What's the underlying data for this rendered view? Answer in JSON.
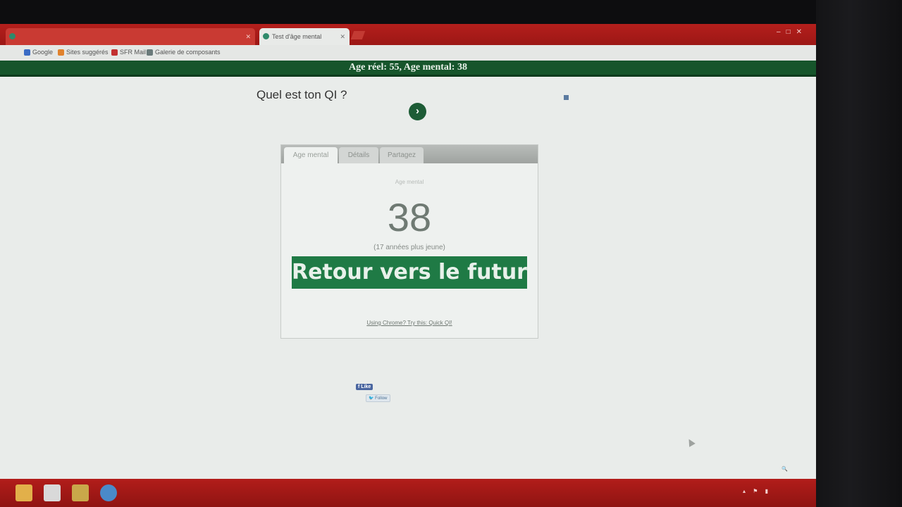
{
  "browser": {
    "tabs": [
      {
        "title": "",
        "active": false
      },
      {
        "title": "Test d'âge mental",
        "active": true
      }
    ],
    "bookmarks": [
      {
        "label": "Google",
        "color": "#3b6cc5"
      },
      {
        "label": "Sites suggérés",
        "color": "#e0822d"
      },
      {
        "label": "SFR Mail",
        "color": "#c23030"
      },
      {
        "label": "Galerie de composants",
        "color": "#6a7a7a"
      }
    ]
  },
  "banner": {
    "text": "Age réel: 55, Age mental: 38"
  },
  "promo": {
    "title": "Quel est ton QI ?",
    "line1": "",
    "line2": "",
    "button_icon": "chevron-right-icon"
  },
  "result": {
    "tabs": [
      "Age mental",
      "Détails",
      "Partagez"
    ],
    "caption": "Age mental",
    "age": "38",
    "difference": "(17 années plus jeune)",
    "button_label": "Retour vers le futur",
    "info": "",
    "chrome_link": "Using Chrome? Try this: Quick QI!"
  },
  "social": {
    "like_label": "Like",
    "like_count": "",
    "follow_label": "Follow",
    "follow_count": ""
  },
  "colors": {
    "brand_green": "#16552b",
    "button_green": "#1f7a45",
    "chrome_red": "#b41f1c"
  }
}
